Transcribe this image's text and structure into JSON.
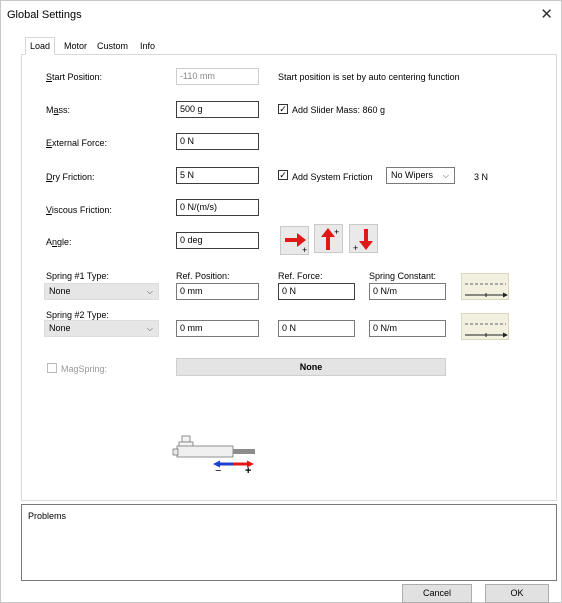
{
  "dialog": {
    "title": "Global Settings",
    "close_glyph": "✕"
  },
  "tabs": [
    {
      "label": "Load",
      "active": true
    },
    {
      "label": "Motor",
      "active": false
    },
    {
      "label": "Custom",
      "active": false
    },
    {
      "label": "Info",
      "active": false
    }
  ],
  "load": {
    "start_position": {
      "label": "Start Position:",
      "value": "-110 mm",
      "note": "Start position is set by auto centering function"
    },
    "mass": {
      "label": "Mass:",
      "value": "500 g",
      "add_slider_mass_label": "Add Slider Mass: 860 g",
      "add_slider_mass_checked": true
    },
    "external_force": {
      "label": "External Force:",
      "value": "0 N"
    },
    "dry_friction": {
      "label": "Dry Friction:",
      "value": "5 N",
      "add_system_friction_label": "Add System Friction",
      "add_system_friction_checked": true,
      "wipers_selected": "No Wipers",
      "system_friction_value": "3 N"
    },
    "viscous_friction": {
      "label": "Viscous Friction:",
      "value": "0 N/(m/s)"
    },
    "angle": {
      "label": "Angle:",
      "value": "0 deg"
    },
    "spring_columns": {
      "ref_position": "Ref. Position:",
      "ref_force": "Ref. Force:",
      "spring_constant": "Spring Constant:"
    },
    "spring1": {
      "label": "Spring #1 Type:",
      "type": "None",
      "ref_position": "0 mm",
      "ref_force": "0 N",
      "spring_constant": "0 N/m"
    },
    "spring2": {
      "label": "Spring #2 Type:",
      "type": "None",
      "ref_position": "0 mm",
      "ref_force": "0 N",
      "spring_constant": "0 N/m"
    },
    "magspring": {
      "label": "MagSpring:",
      "checked": false,
      "value": "None"
    },
    "actuator_minus": "−",
    "actuator_plus": "+",
    "check_glyph": "✓",
    "chevron_glyph": "⌵"
  },
  "problems": {
    "label": "Problems"
  },
  "buttons": {
    "cancel": "Cancel",
    "ok": "OK"
  },
  "colors": {
    "arrow_red": "#e01818",
    "arrow_blue": "#1f3fd0",
    "spring_bg": "#f3f0e0"
  }
}
